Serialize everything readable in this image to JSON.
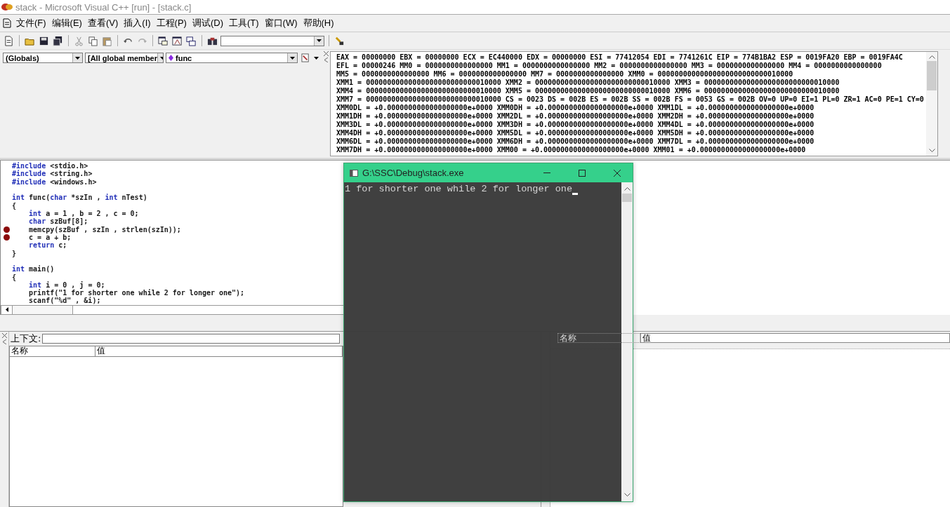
{
  "window": {
    "title": "stack - Microsoft Visual C++ [run] - [stack.c]"
  },
  "menu": [
    "文件(F)",
    "编辑(E)",
    "查看(V)",
    "插入(I)",
    "工程(P)",
    "调试(D)",
    "工具(T)",
    "窗口(W)",
    "帮助(H)"
  ],
  "wizard_bar": {
    "class_combo": "(Globals)",
    "filter_combo": "[All global member",
    "member_combo": "func"
  },
  "registers": [
    "EAX = 00000000 EBX = 00000000 ECX = EC440000 EDX = 00000000 ESI = 77412054 EDI = 7741261C EIP = 774B1BA2 ESP = 0019FA20 EBP = 0019FA4C",
    "EFL = 00000246 MM0 = 0000000000000000 MM1 = 0000000000000000 MM2 = 0000000000000000 MM3 = 0000000000000000 MM4 = 0000000000000000",
    "MM5 = 0000000000000000 MM6 = 0000000000000000 MM7 = 0000000000000000 XMM0 = 00000000000000000000000000010000",
    "XMM1 = 00000000000000000000000000010000 XMM2 = 00000000000000000000000000010000 XMM3 = 00000000000000000000000000010000",
    "XMM4 = 00000000000000000000000000010000 XMM5 = 00000000000000000000000000010000 XMM6 = 00000000000000000000000000010000",
    "XMM7 = 00000000000000000000000000010000 CS = 0023 DS = 002B ES = 002B SS = 002B FS = 0053 GS = 002B OV=0 UP=0 EI=1 PL=0 ZR=1 AC=0 PE=1 CY=0",
    "XMM0DL = +0.0000000000000000000e+0000 XMM0DH = +0.0000000000000000000e+0000 XMM1DL = +0.0000000000000000000e+0000",
    "XMM1DH = +0.0000000000000000000e+0000 XMM2DL = +0.0000000000000000000e+0000 XMM2DH = +0.0000000000000000000e+0000",
    "XMM3DL = +0.0000000000000000000e+0000 XMM3DH = +0.0000000000000000000e+0000 XMM4DL = +0.0000000000000000000e+0000",
    "XMM4DH = +0.0000000000000000000e+0000 XMM5DL = +0.0000000000000000000e+0000 XMM5DH = +0.0000000000000000000e+0000",
    "XMM6DL = +0.0000000000000000000e+0000 XMM6DH = +0.0000000000000000000e+0000 XMM7DL = +0.0000000000000000000e+0000",
    "XMM7DH = +0.0000000000000000000e+0000 XMM00 = +0.0000000000000000000e+0000 XMM01 = +0.0000000000000000000e+0000"
  ],
  "editor": {
    "lines": [
      {
        "breakpoint": false,
        "segments": [
          {
            "text": "#include",
            "kind": "keyword"
          },
          {
            "text": " <stdio.h>",
            "kind": "plain"
          }
        ]
      },
      {
        "breakpoint": false,
        "segments": [
          {
            "text": "#include",
            "kind": "keyword"
          },
          {
            "text": " <string.h>",
            "kind": "plain"
          }
        ]
      },
      {
        "breakpoint": false,
        "segments": [
          {
            "text": "#include",
            "kind": "keyword"
          },
          {
            "text": " <windows.h>",
            "kind": "plain"
          }
        ]
      },
      {
        "breakpoint": false
      },
      {
        "breakpoint": false,
        "segments": [
          {
            "text": "int",
            "kind": "keyword"
          },
          {
            "text": " func(",
            "kind": "plain"
          },
          {
            "text": "char",
            "kind": "keyword"
          },
          {
            "text": " *szIn , ",
            "kind": "plain"
          },
          {
            "text": "int",
            "kind": "keyword"
          },
          {
            "text": " nTest)",
            "kind": "plain"
          }
        ]
      },
      {
        "breakpoint": false,
        "segments": [
          {
            "text": "{",
            "kind": "plain"
          }
        ]
      },
      {
        "breakpoint": false,
        "segments": [
          {
            "text": "    int",
            "kind": "keyword"
          },
          {
            "text": " a = 1 , b = 2 , c = 0;",
            "kind": "plain"
          }
        ]
      },
      {
        "breakpoint": false,
        "segments": [
          {
            "text": "    char",
            "kind": "keyword"
          },
          {
            "text": " szBuf[8];",
            "kind": "plain"
          }
        ]
      },
      {
        "breakpoint": true,
        "segments": [
          {
            "text": "    memcpy(szBuf , szIn , strlen(szIn));",
            "kind": "plain"
          }
        ]
      },
      {
        "breakpoint": true,
        "segments": [
          {
            "text": "    c = a + b;",
            "kind": "plain"
          }
        ]
      },
      {
        "breakpoint": false,
        "segments": [
          {
            "text": "    return",
            "kind": "keyword"
          },
          {
            "text": " c;",
            "kind": "plain"
          }
        ]
      },
      {
        "breakpoint": false,
        "segments": [
          {
            "text": "}",
            "kind": "plain"
          }
        ]
      },
      {
        "breakpoint": false
      },
      {
        "breakpoint": false,
        "segments": [
          {
            "text": "int",
            "kind": "keyword"
          },
          {
            "text": " main()",
            "kind": "plain"
          }
        ]
      },
      {
        "breakpoint": false,
        "segments": [
          {
            "text": "{",
            "kind": "plain"
          }
        ]
      },
      {
        "breakpoint": false,
        "segments": [
          {
            "text": "    int",
            "kind": "keyword"
          },
          {
            "text": " i = 0 , j = 0;",
            "kind": "plain"
          }
        ]
      },
      {
        "breakpoint": false,
        "segments": [
          {
            "text": "    printf(\"1 for shorter one while 2 for longer one\");",
            "kind": "plain"
          }
        ]
      },
      {
        "breakpoint": false,
        "segments": [
          {
            "text": "    scanf(\"%d\" , &i);",
            "kind": "plain"
          }
        ]
      }
    ]
  },
  "variables": {
    "context_label": "上下文:",
    "columns": [
      "名称",
      "值"
    ]
  },
  "watch": {
    "columns": [
      "名称",
      "值"
    ]
  },
  "console": {
    "title": "G:\\SSC\\Debug\\stack.exe",
    "output": "1 for shorter one while 2 for longer one"
  }
}
